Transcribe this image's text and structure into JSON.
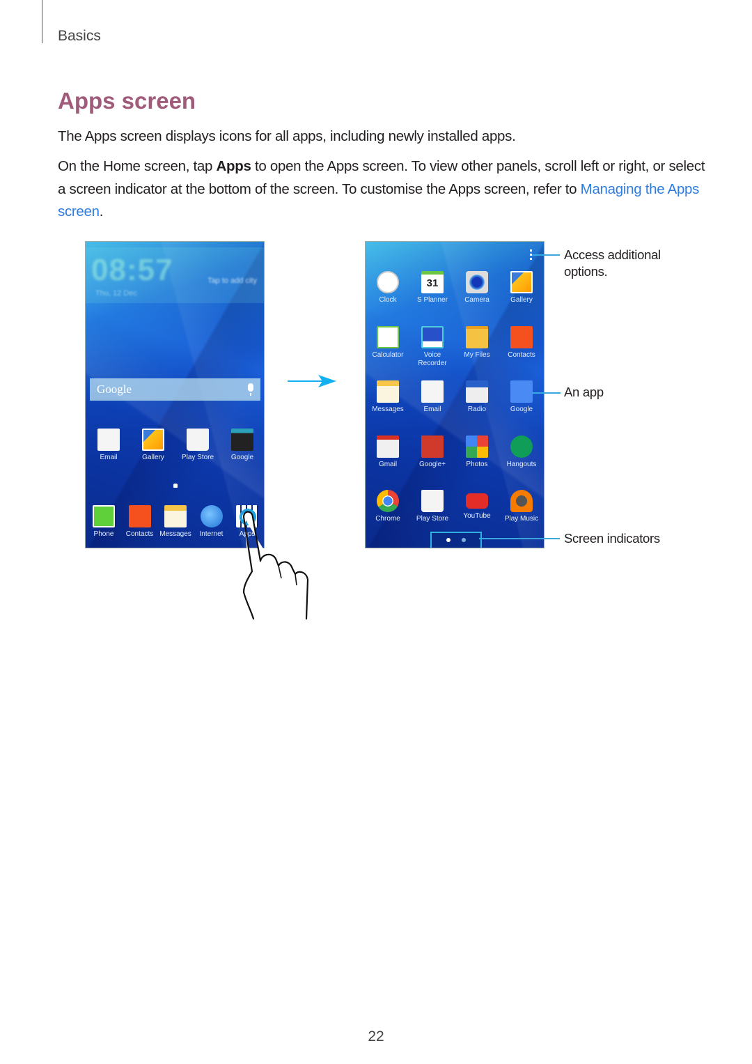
{
  "header": {
    "section": "Basics"
  },
  "title": "Apps screen",
  "paragraphs": {
    "p1": "The Apps screen displays icons for all apps, including newly installed apps.",
    "p2_before": "On the Home screen, tap ",
    "p2_bold": "Apps",
    "p2_after": " to open the Apps screen. To view other panels, scroll left or right, or select a screen indicator at the bottom of the screen. To customise the Apps screen, refer to ",
    "p2_link": "Managing the Apps screen",
    "p2_end": "."
  },
  "home_screen": {
    "clock": {
      "time": "08:57",
      "date": "Thu, 12 Dec",
      "city": "Tap to add city"
    },
    "search": {
      "label": "Google",
      "icon": "mic-icon"
    },
    "apps_row": [
      {
        "label": "Email",
        "icon": "email-icon"
      },
      {
        "label": "Gallery",
        "icon": "gallery-icon"
      },
      {
        "label": "Play Store",
        "icon": "play-store-icon"
      },
      {
        "label": "Google",
        "icon": "google-folder-icon"
      }
    ],
    "dock": [
      {
        "label": "Phone",
        "icon": "phone-icon"
      },
      {
        "label": "Contacts",
        "icon": "contacts-icon"
      },
      {
        "label": "Messages",
        "icon": "messages-icon"
      },
      {
        "label": "Internet",
        "icon": "internet-icon"
      },
      {
        "label": "Apps",
        "icon": "apps-grid-icon"
      }
    ]
  },
  "apps_screen": {
    "menu_icon": "more-options-icon",
    "apps": [
      {
        "label": "Clock",
        "icon": "clock-icon"
      },
      {
        "label": "S Planner",
        "icon": "calendar-icon",
        "badge": "31"
      },
      {
        "label": "Camera",
        "icon": "camera-icon"
      },
      {
        "label": "Gallery",
        "icon": "gallery-icon"
      },
      {
        "label": "Calculator",
        "icon": "calculator-icon"
      },
      {
        "label": "Voice\nRecorder",
        "icon": "voice-recorder-icon"
      },
      {
        "label": "My Files",
        "icon": "folder-icon"
      },
      {
        "label": "Contacts",
        "icon": "contacts-icon"
      },
      {
        "label": "Messages",
        "icon": "messages-icon"
      },
      {
        "label": "Email",
        "icon": "email-icon"
      },
      {
        "label": "Radio",
        "icon": "radio-icon"
      },
      {
        "label": "Google",
        "icon": "google-icon"
      },
      {
        "label": "Gmail",
        "icon": "gmail-icon"
      },
      {
        "label": "Google+",
        "icon": "google-plus-icon"
      },
      {
        "label": "Photos",
        "icon": "photos-icon"
      },
      {
        "label": "Hangouts",
        "icon": "hangouts-icon"
      },
      {
        "label": "Chrome",
        "icon": "chrome-icon"
      },
      {
        "label": "Play Store",
        "icon": "play-store-icon"
      },
      {
        "label": "YouTube",
        "icon": "youtube-icon"
      },
      {
        "label": "Play Music",
        "icon": "play-music-icon"
      }
    ],
    "indicators": {
      "count": 2,
      "active": 1
    }
  },
  "callouts": {
    "options": "Access additional options.",
    "app": "An app",
    "indicators": "Screen indicators"
  },
  "colors": {
    "title": "#a05a7a",
    "link": "#2f7ce0",
    "callout": "#3aa8e0"
  },
  "page_number": "22"
}
